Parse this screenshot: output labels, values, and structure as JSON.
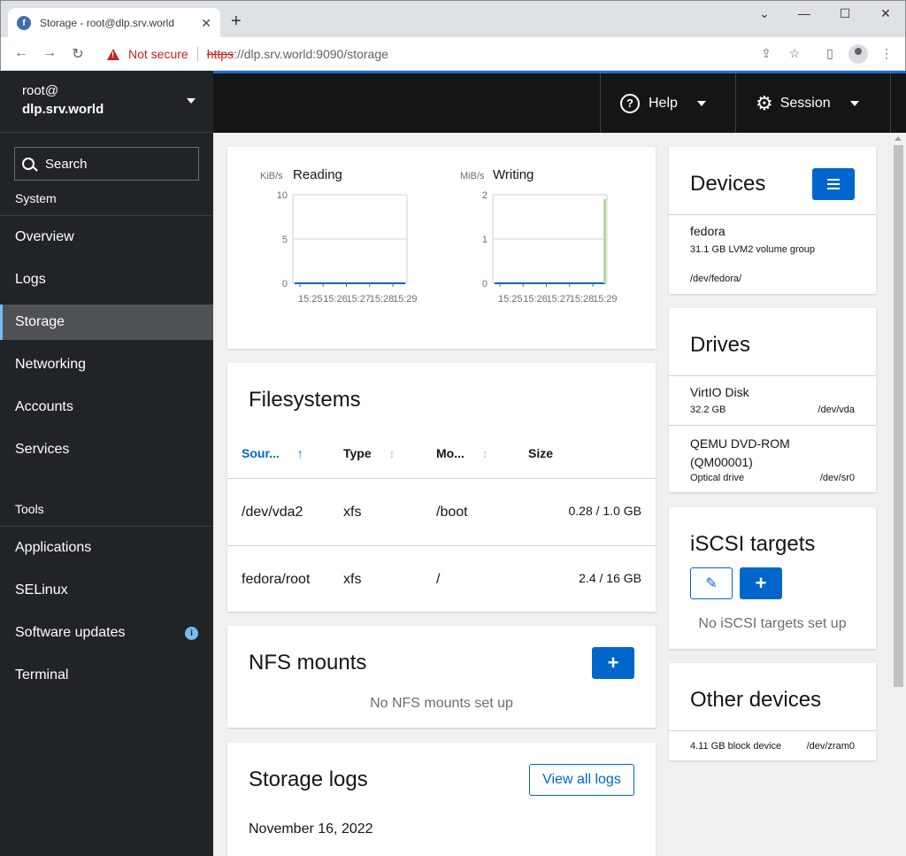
{
  "browser": {
    "tab_title": "Storage - root@dlp.srv.world",
    "not_secure": "Not secure",
    "url_scheme": "https",
    "url_rest": "://dlp.srv.world:9090/storage"
  },
  "host": {
    "user": "root@",
    "name": "dlp.srv.world"
  },
  "sidebar": {
    "search_placeholder": "Search",
    "system_label": "System",
    "tools_label": "Tools",
    "system_items": [
      "Overview",
      "Logs",
      "Storage",
      "Networking",
      "Accounts",
      "Services"
    ],
    "tool_items": [
      "Applications",
      "SELinux",
      "Software updates",
      "Terminal"
    ],
    "active": "Storage"
  },
  "topbar": {
    "help": "Help",
    "session": "Session"
  },
  "charts": {
    "reading": {
      "unit": "KiB/s",
      "title": "Reading"
    },
    "writing": {
      "unit": "MiB/s",
      "title": "Writing"
    }
  },
  "chart_data": [
    {
      "type": "line",
      "title": "Reading",
      "ylabel": "KiB/s",
      "ylim": [
        0,
        10
      ],
      "yticks": [
        "10",
        "5",
        "0"
      ],
      "xticks": [
        "15:25",
        "15:26",
        "15:27",
        "15:28",
        "15:29"
      ],
      "x": [
        "15:25",
        "15:26",
        "15:27",
        "15:28",
        "15:29"
      ],
      "values": [
        0,
        0,
        0,
        0,
        0
      ]
    },
    {
      "type": "line",
      "title": "Writing",
      "ylabel": "MiB/s",
      "ylim": [
        0,
        2
      ],
      "yticks": [
        "2",
        "1",
        "0"
      ],
      "xticks": [
        "15:25",
        "15:26",
        "15:27",
        "15:28",
        "15:29"
      ],
      "x": [
        "15:25",
        "15:26",
        "15:27",
        "15:28",
        "15:29"
      ],
      "values": [
        0,
        0,
        0,
        0,
        1.9
      ]
    }
  ],
  "filesystems": {
    "title": "Filesystems",
    "columns": [
      "Sour...",
      "Type",
      "Mo...",
      "Size"
    ],
    "rows": [
      {
        "source": "/dev/vda2",
        "type": "xfs",
        "mount": "/boot",
        "size": "0.28 / 1.0 GB"
      },
      {
        "source": "fedora/root",
        "type": "xfs",
        "mount": "/",
        "size": "2.4 / 16 GB"
      }
    ]
  },
  "nfs": {
    "title": "NFS mounts",
    "empty": "No NFS mounts set up"
  },
  "logs": {
    "title": "Storage logs",
    "view_all": "View all logs",
    "date": "November 16, 2022"
  },
  "devices": {
    "title": "Devices",
    "items": [
      {
        "name": "fedora",
        "desc": "31.1 GB LVM2 volume group",
        "path": "/dev/fedora/"
      }
    ]
  },
  "drives": {
    "title": "Drives",
    "items": [
      {
        "name": "VirtIO Disk",
        "desc": "32.2 GB",
        "path": "/dev/vda"
      },
      {
        "name": "QEMU DVD-ROM (QM00001)",
        "desc": "Optical drive",
        "path": "/dev/sr0"
      }
    ]
  },
  "iscsi": {
    "title": "iSCSI targets",
    "empty": "No iSCSI targets set up"
  },
  "other": {
    "title": "Other devices",
    "items": [
      {
        "desc": "4.11 GB block device",
        "path": "/dev/zram0"
      }
    ]
  },
  "colors": {
    "accent": "#0066cc",
    "sidebar": "#212427",
    "topbar": "#151515",
    "chart_line": "#0066cc",
    "write_bar": "#b5d89a"
  }
}
